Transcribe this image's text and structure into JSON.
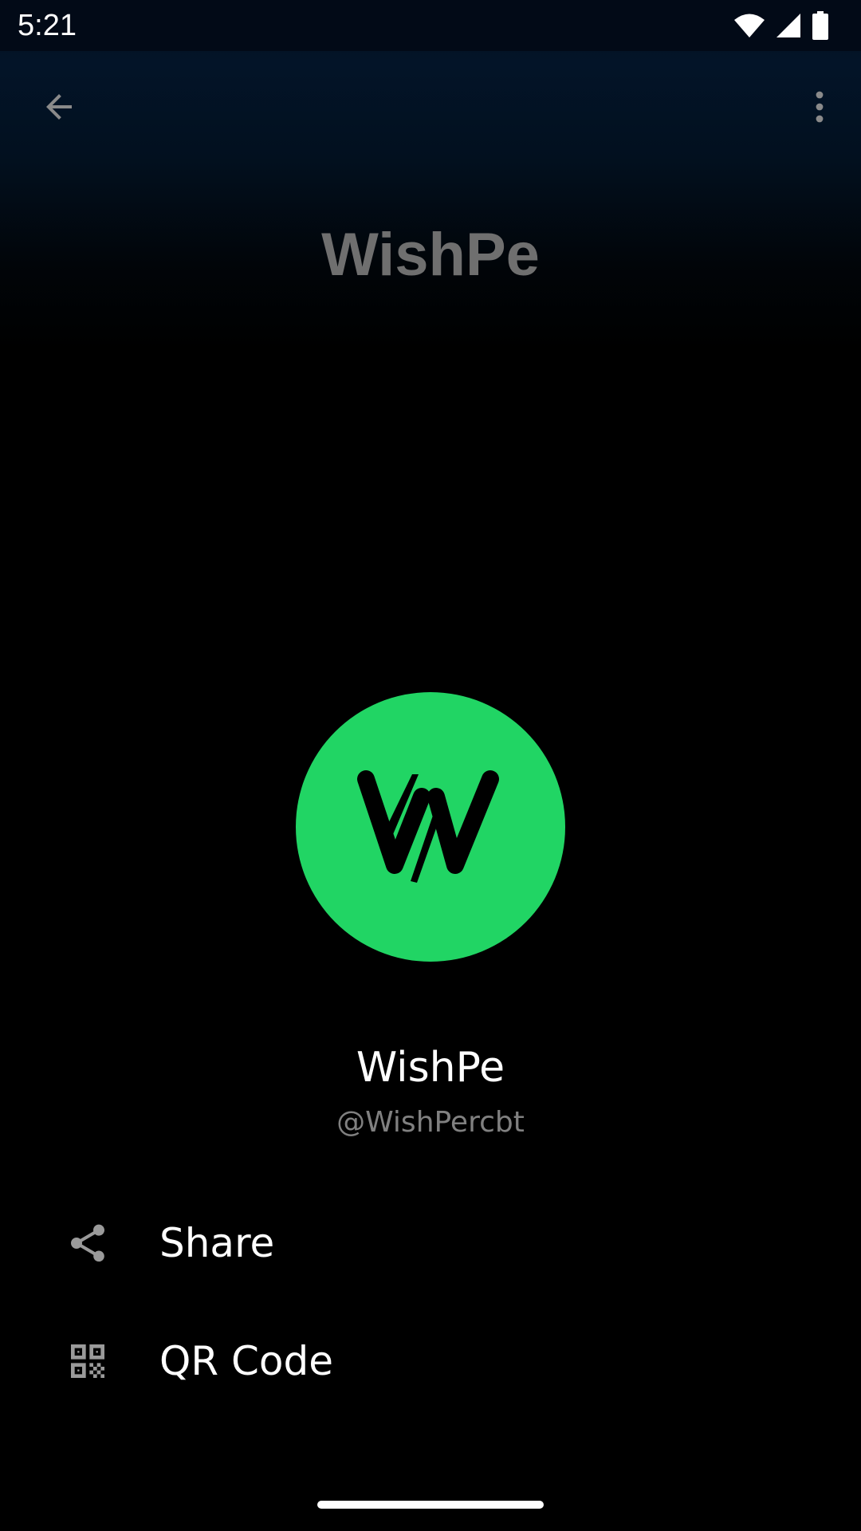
{
  "status_bar": {
    "time": "5:21",
    "icons": [
      "wifi-icon",
      "cellular-signal-icon",
      "battery-icon"
    ]
  },
  "app_bar": {
    "back_icon": "arrow-back-icon",
    "more_icon": "more-vert-icon"
  },
  "header": {
    "title": "WishPe"
  },
  "profile": {
    "avatar_icon": "wishpe-w-logo",
    "avatar_color": "#21d564",
    "name": "WishPe",
    "handle": "@WishPercbt"
  },
  "actions": [
    {
      "icon": "share-icon",
      "label": "Share"
    },
    {
      "icon": "qr-code-icon",
      "label": "QR Code"
    }
  ],
  "colors": {
    "background": "#000000",
    "header_gradient_top": "#031428",
    "title_gray": "#6f6f6f",
    "handle_gray": "#808080",
    "icon_gray": "#9a9a9a",
    "accent_green": "#21d564"
  }
}
